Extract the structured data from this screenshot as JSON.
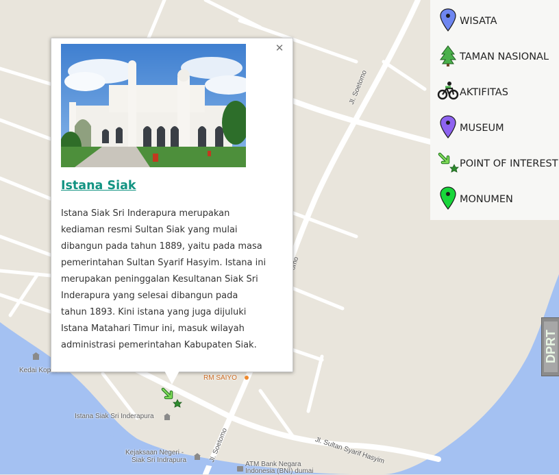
{
  "colors": {
    "land": "#e9e5dc",
    "water": "#a4c1f2",
    "road": "#ffffff",
    "link_teal": "#129382",
    "wisata_marker": "#6e86f0",
    "museum_marker": "#8e63f0",
    "monumen_marker": "#18d63a",
    "park_green": "#4bb04b"
  },
  "map": {
    "labels": {
      "kedai": "Kedai Kopi Amin",
      "rm_saiyo": "RM SAIYO",
      "istana": "Istana Siak Sri Inderapura",
      "kejaksaan_1": "Kejaksaan Negeri -",
      "kejaksaan_2": "Siak Sri Indrapura",
      "atm_1": "ATM Bank Negara",
      "atm_2": "Indonesia (BNI) dumai",
      "road_soetomo_top": "Jl. Soetomo",
      "road_soetomo_mid": "omo",
      "road_soetomo_bottom": "Jl. Soetomo",
      "road_sultan": "Jl. Sultan Syarif Hasyim"
    },
    "marker_icon": "point-of-interest-icon"
  },
  "infowindow": {
    "title": "Istana Siak",
    "close_icon": "close-icon",
    "photo_alt": "Istana Siak palace photo",
    "description": "Istana Siak Sri Inderapura merupakan kediaman resmi Sultan Siak yang mulai dibangun pada tahun 1889, yaitu pada masa pemerintahan Sultan Syarif Hasyim. Istana ini merupakan peninggalan Kesultanan Siak Sri Inderapura yang selesai dibangun pada tahun 1893. Kini istana yang juga dijuluki Istana Matahari Timur ini, masuk wilayah administrasi pemerintahan Kabupaten Siak."
  },
  "legend": {
    "items": [
      {
        "label": "WISATA",
        "icon": "blue-pin-icon"
      },
      {
        "label": "TAMAN NASIONAL",
        "icon": "tree-icon"
      },
      {
        "label": "AKTIFITAS",
        "icon": "bicycle-icon"
      },
      {
        "label": "MUSEUM",
        "icon": "purple-pin-icon"
      },
      {
        "label": "POINT OF INTEREST",
        "icon": "point-of-interest-icon"
      },
      {
        "label": "MONUMEN",
        "icon": "green-pin-icon"
      }
    ]
  },
  "side_tab": {
    "text": "DPRT"
  }
}
